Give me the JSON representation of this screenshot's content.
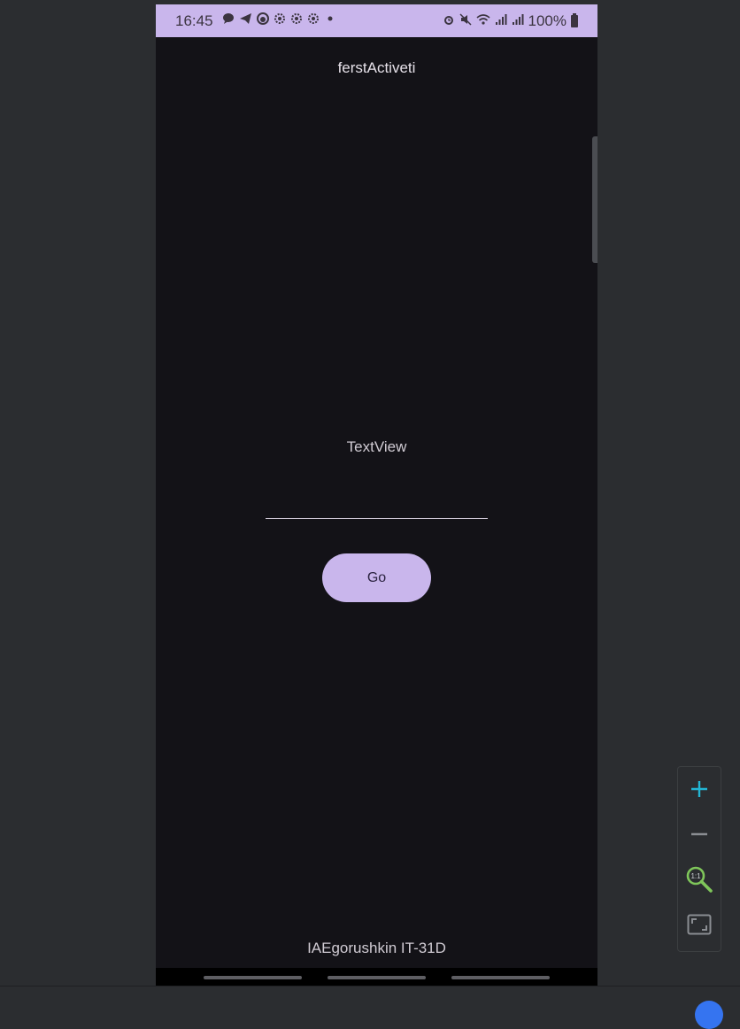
{
  "status_bar": {
    "time": "16:45",
    "battery_percent": "100%",
    "notification_icons": [
      "chat-bubble-icon",
      "telegram-icon",
      "app-icon",
      "gear-icon",
      "gear-icon",
      "gear-icon",
      "dot-icon"
    ],
    "system_icons": [
      "alarm-icon",
      "mute-icon",
      "wifi-icon",
      "signal-icon",
      "signal-icon",
      "battery-icon"
    ]
  },
  "app": {
    "title": "ferstActiveti",
    "text_view": "TextView",
    "input_value": "",
    "go_button_label": "Go",
    "footer": "IAEgorushkin IT-31D"
  },
  "zoom_controls": {
    "items": [
      "zoom-in",
      "zoom-out",
      "actual-size",
      "fit-screen"
    ],
    "actual_size_label": "1:1"
  },
  "colors": {
    "status_bar": "#c9b6ec",
    "app_background": "#131217",
    "button": "#c9b6ec",
    "ide_background": "#2b2d30",
    "zoom_in_accent": "#23b5d3",
    "actual_size_accent": "#7fc65a"
  }
}
